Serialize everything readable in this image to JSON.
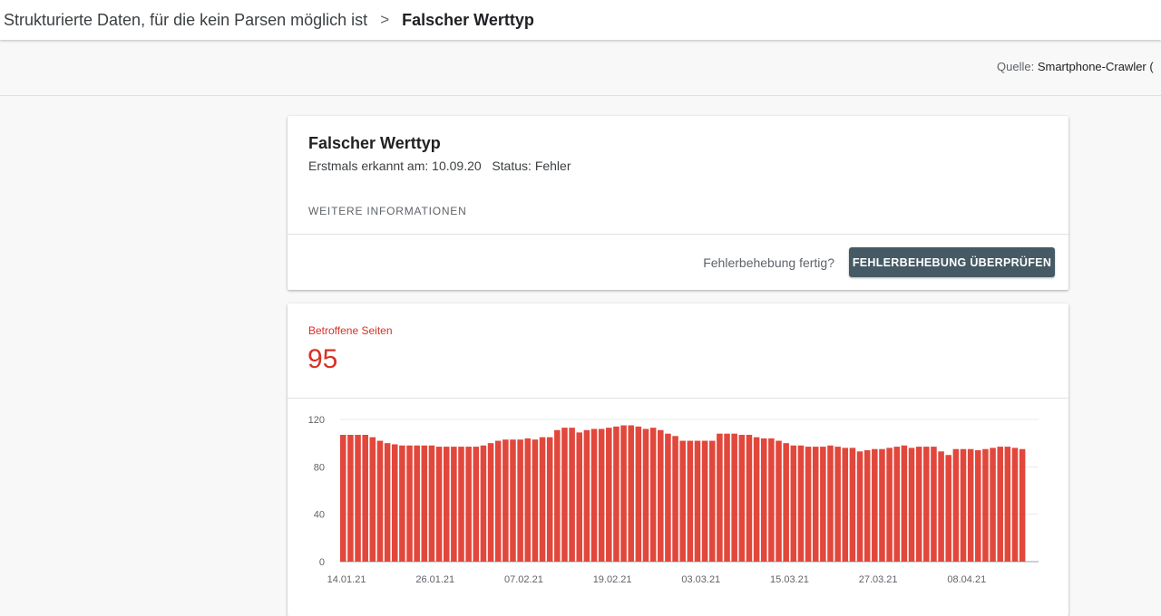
{
  "breadcrumb": {
    "parent": "Strukturierte Daten, für die kein Parsen möglich ist",
    "separator": ">",
    "current": "Falscher Werttyp"
  },
  "source": {
    "label": "Quelle:",
    "value": "Smartphone-Crawler ("
  },
  "issue": {
    "title": "Falscher Werttyp",
    "first_detected_label": "Erstmals erkannt am:",
    "first_detected_value": "10.09.20",
    "status_label": "Status:",
    "status_value": "Fehler",
    "more_info": "WEITERE INFORMATIONEN",
    "fix_question": "Fehlerbehebung fertig?",
    "validate_button": "FEHLERBEHEBUNG ÜBERPRÜFEN"
  },
  "metric": {
    "label": "Betroffene Seiten",
    "value": "95"
  },
  "colors": {
    "accent": "#d93025",
    "bar": "#e2473c",
    "button": "#455a64"
  },
  "chart_data": {
    "type": "bar",
    "title": "",
    "xlabel": "",
    "ylabel": "",
    "ylim": [
      0,
      120
    ],
    "yticks": [
      0,
      40,
      80,
      120
    ],
    "grid": true,
    "x_tick_labels": [
      "14.01.21",
      "26.01.21",
      "07.02.21",
      "19.02.21",
      "03.03.21",
      "15.03.21",
      "27.03.21",
      "08.04.21"
    ],
    "values": [
      107,
      107,
      107,
      107,
      105,
      102,
      100,
      99,
      98,
      98,
      98,
      98,
      98,
      97,
      97,
      97,
      97,
      97,
      97,
      98,
      100,
      102,
      103,
      103,
      103,
      104,
      103,
      105,
      105,
      111,
      113,
      113,
      109,
      111,
      112,
      112,
      113,
      114,
      115,
      115,
      114,
      112,
      113,
      111,
      108,
      106,
      102,
      102,
      102,
      102,
      102,
      108,
      108,
      108,
      107,
      107,
      105,
      104,
      104,
      102,
      100,
      98,
      98,
      97,
      97,
      97,
      98,
      97,
      96,
      96,
      93,
      94,
      95,
      95,
      96,
      97,
      98,
      96,
      97,
      97,
      97,
      93,
      90,
      95,
      95,
      95,
      94,
      95,
      96,
      97,
      97,
      96,
      95
    ]
  }
}
